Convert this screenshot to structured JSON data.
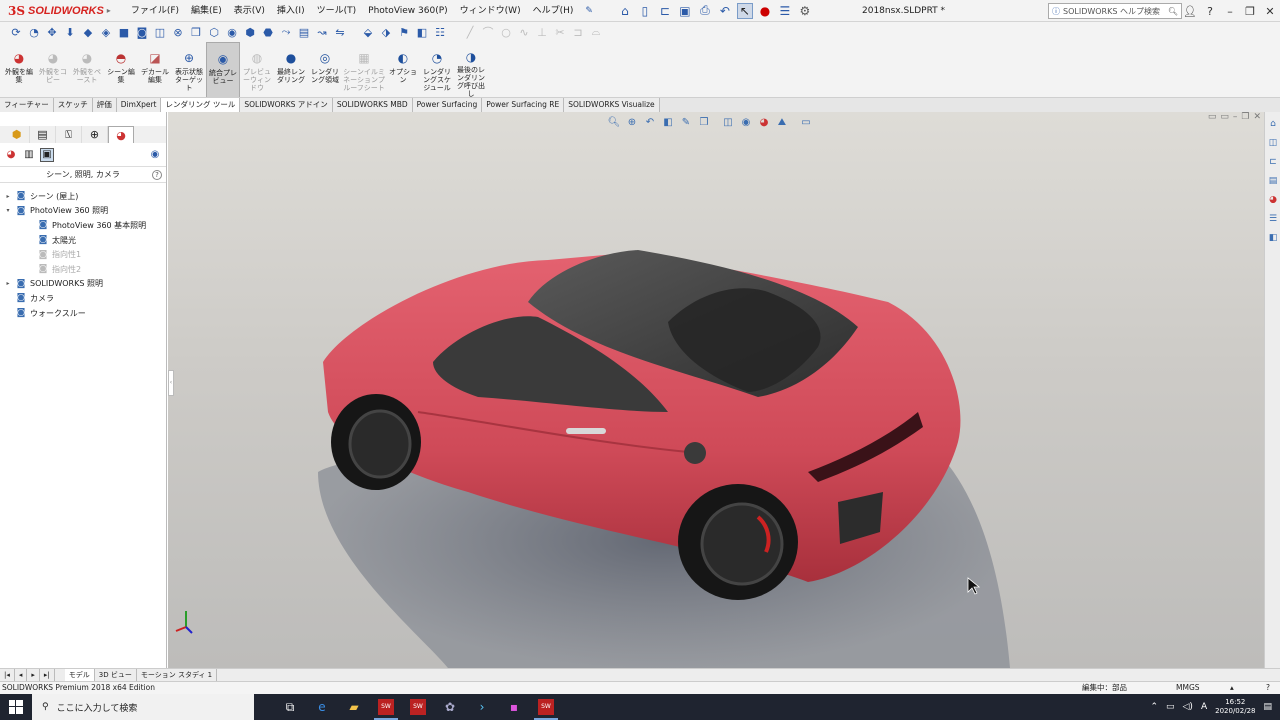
{
  "app": {
    "logo_ds": "3S",
    "logo_name": "SOLIDWORKS",
    "document_title": "2018nsx.SLDPRT *",
    "help_search_placeholder": "SOLIDWORKS ヘルプ検索"
  },
  "menu": [
    "ファイル(F)",
    "編集(E)",
    "表示(V)",
    "挿入(I)",
    "ツール(T)",
    "PhotoView 360(P)",
    "ウィンドウ(W)",
    "ヘルプ(H)"
  ],
  "command_manager": [
    {
      "label": "外観を編集",
      "icon": "appearance-icon",
      "enabled": true
    },
    {
      "label": "外観をコピー",
      "icon": "copy-appearance-icon",
      "enabled": false
    },
    {
      "label": "外観をペースト",
      "icon": "paste-appearance-icon",
      "enabled": false
    },
    {
      "label": "シーン編集",
      "icon": "scene-icon",
      "enabled": true
    },
    {
      "label": "デカール編集",
      "icon": "decal-icon",
      "enabled": true
    },
    {
      "label": "表示状態ターゲット",
      "icon": "target-icon",
      "enabled": true
    },
    {
      "label": "統合プレビュー",
      "icon": "integrated-preview-icon",
      "enabled": true,
      "active": true
    },
    {
      "label": "プレビューウィンドウ",
      "icon": "preview-window-icon",
      "enabled": false
    },
    {
      "label": "最終レンダリング",
      "icon": "final-render-icon",
      "enabled": true
    },
    {
      "label": "レンダリング領域",
      "icon": "render-region-icon",
      "enabled": true
    },
    {
      "label": "シーンイルミネーションプルーフシート",
      "icon": "proof-sheet-icon",
      "enabled": false
    },
    {
      "label": "オプション",
      "icon": "options-icon",
      "enabled": true
    },
    {
      "label": "レンダリングスケジュール",
      "icon": "schedule-icon",
      "enabled": true
    },
    {
      "label": "最後のレンダリング呼び出し",
      "icon": "recall-render-icon",
      "enabled": true
    }
  ],
  "tabs": [
    "フィーチャー",
    "スケッチ",
    "評価",
    "DimXpert",
    "レンダリング ツール",
    "SOLIDWORKS アドイン",
    "SOLIDWORKS MBD",
    "Power Surfacing",
    "Power Surfacing RE",
    "SOLIDWORKS Visualize"
  ],
  "active_tab": "レンダリング ツール",
  "left_panel": {
    "title": "シーン, 照明, カメラ",
    "tree": [
      {
        "label": "シーン (屋上)",
        "indent": 0,
        "arrow": "▸",
        "icon": "scene-icon",
        "dim": false
      },
      {
        "label": "PhotoView 360 照明",
        "indent": 0,
        "arrow": "▾",
        "icon": "photoview-light-icon",
        "dim": false
      },
      {
        "label": "PhotoView 360 基本照明",
        "indent": 1,
        "arrow": "",
        "icon": "basic-light-icon",
        "dim": false
      },
      {
        "label": "太陽光",
        "indent": 1,
        "arrow": "",
        "icon": "sun-icon",
        "dim": false
      },
      {
        "label": "指向性1",
        "indent": 1,
        "arrow": "",
        "icon": "directional-light-icon",
        "dim": true
      },
      {
        "label": "指向性2",
        "indent": 1,
        "arrow": "",
        "icon": "directional-light-icon",
        "dim": true
      },
      {
        "label": "SOLIDWORKS 照明",
        "indent": 0,
        "arrow": "▸",
        "icon": "sw-light-icon",
        "dim": false
      },
      {
        "label": "カメラ",
        "indent": 0,
        "arrow": "",
        "icon": "camera-icon",
        "dim": false
      },
      {
        "label": "ウォークスルー",
        "indent": 0,
        "arrow": "",
        "icon": "walkthrough-icon",
        "dim": false
      }
    ]
  },
  "bottom_tabs": [
    "モデル",
    "3D ビュー",
    "モーション スタディ 1"
  ],
  "status": {
    "edition": "SOLIDWORKS Premium 2018 x64 Edition",
    "editing": "編集中：部品",
    "units": "MMGS"
  },
  "taskbar": {
    "search_placeholder": "ここに入力して検索",
    "time": "16:52",
    "date": "2020/02/28",
    "ime": "A"
  },
  "colors": {
    "car_body": "#cf4a58",
    "brand_red": "#d6221f"
  }
}
